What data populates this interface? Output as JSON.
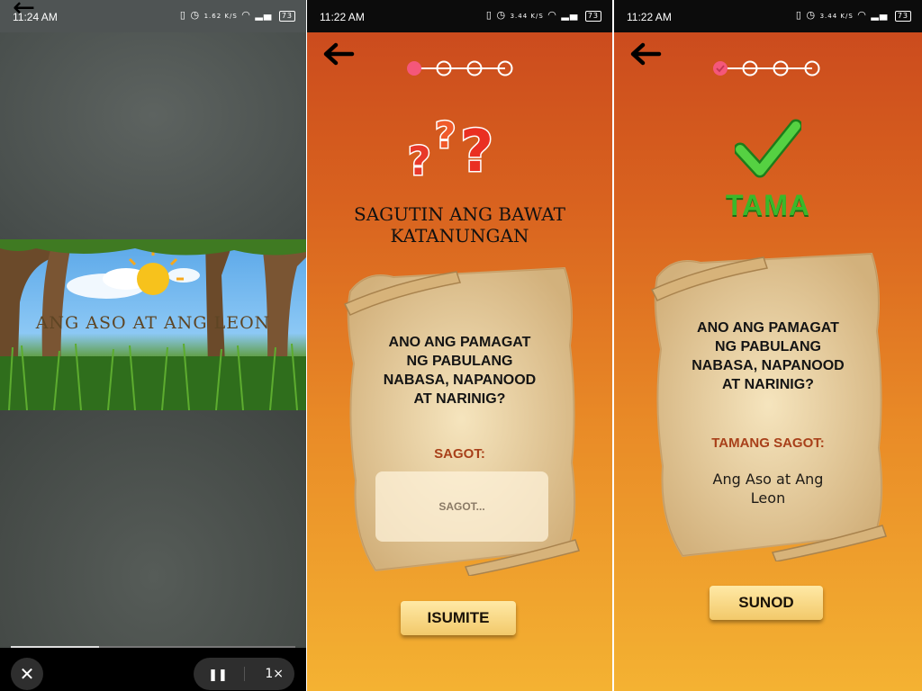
{
  "screens": [
    {
      "status": {
        "time": "11:24 AM",
        "net": "1.62 K/S",
        "battery": "73"
      },
      "video": {
        "title": "ANG ASO AT ANG LEON"
      },
      "player": {
        "close_label": "✕",
        "pause_label": "❚❚",
        "speed_label": "1×",
        "progress": 0.31
      }
    },
    {
      "status": {
        "time": "11:22 AM",
        "net": "3.44 K/S",
        "battery": "73"
      },
      "heading_line1": "SAGUTIN ANG BAWAT",
      "heading_line2": "KATANUNGAN",
      "question_lines": [
        "ANO ANG PAMAGAT",
        "NG PABULANG",
        "NABASA, NAPANOOD",
        "AT NARINIG?"
      ],
      "answer_label": "SAGOT:",
      "answer_placeholder": "SAGOT...",
      "submit_label": "ISUMITE",
      "current_step": 1,
      "total_steps": 4
    },
    {
      "status": {
        "time": "11:22 AM",
        "net": "3.44 K/S",
        "battery": "73"
      },
      "result": "TAMA",
      "question_lines": [
        "ANO ANG PAMAGAT",
        "NG PABULANG",
        "NABASA, NAPANOOD",
        "AT NARINIG?"
      ],
      "answer_label": "TAMANG SAGOT:",
      "answer_lines": [
        "Ang Aso at Ang",
        "Leon"
      ],
      "next_label": "SUNOD",
      "completed_steps": 1,
      "total_steps": 4
    }
  ],
  "colors": {
    "accent": "#f4577a",
    "answer_label": "#a8401a",
    "correct": "#3ab82a"
  },
  "icons": [
    "back-arrow-icon",
    "question-marks-icon",
    "check-icon",
    "close-icon",
    "pause-icon"
  ]
}
